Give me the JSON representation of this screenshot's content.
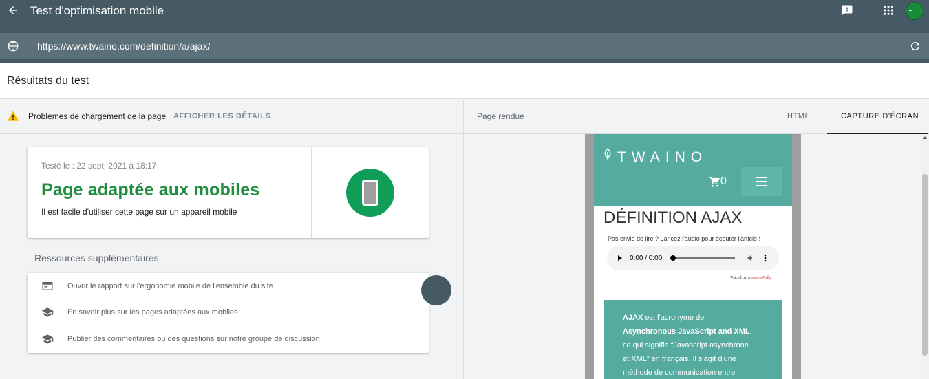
{
  "header": {
    "title": "Test d'optimisation mobile",
    "url": "https://www.twaino.com/definition/a/ajax/",
    "icons": [
      "arrow-back-icon",
      "feedback-icon",
      "apps-grid-icon",
      "globe-icon",
      "refresh-icon"
    ],
    "brand_color": "#455a64"
  },
  "results": {
    "title": "Résultats du test"
  },
  "issues": {
    "text": "Problèmes de chargement de la page",
    "details_label": "AFFICHER LES DÉTAILS",
    "warning_color": "#fbbc04"
  },
  "verdict": {
    "tested_on": "Testé le : 22 sept. 2021 à 18:17",
    "status": "Page adaptée aux mobiles",
    "description": "Il est facile d'utiliser cette page sur un appareil mobile",
    "color": "#1e8e3e"
  },
  "resources": {
    "title": "Ressources supplémentaires",
    "items": [
      {
        "icon": "report-window-icon",
        "label": "Ouvrir le rapport sur l'ergonomie mobile de l'ensemble du site"
      },
      {
        "icon": "graduation-cap-icon",
        "label": "En savoir plus sur les pages adaptées aux mobiles"
      },
      {
        "icon": "graduation-cap-icon",
        "label": "Publier des commentaires ou des questions sur notre groupe de discussion"
      }
    ]
  },
  "preview": {
    "rendered_label": "Page rendue",
    "tabs": [
      "HTML",
      "CAPTURE D'ÉCRAN"
    ],
    "selected_tab": "CAPTURE D'ÉCRAN"
  },
  "site": {
    "brand": "TWAINO",
    "cart_count": "0",
    "heading": "DÉFINITION AJAX",
    "audio_prompt": "Pas envie de lire ? Lancez l'audio pour écouter l'article !",
    "audio_time": "0:00 / 0:00",
    "voiced_by": "Voiced by",
    "voiced_brand": "Amazon Polly",
    "accent_color": "#55aba0",
    "body_lines": [
      {
        "prefix": "",
        "bold": "AJAX",
        "suffix": " est l'acronyme de"
      },
      {
        "prefix": "",
        "bold": "Asynchronous JavaScript and XML",
        "suffix": ","
      },
      {
        "prefix": "ce qui signifie “Javascript asynchrone",
        "bold": "",
        "suffix": ""
      },
      {
        "prefix": "et XML” en français. Il s'agit d'une",
        "bold": "",
        "suffix": ""
      },
      {
        "prefix": "méthode de communication entre",
        "bold": "",
        "suffix": ""
      }
    ]
  }
}
